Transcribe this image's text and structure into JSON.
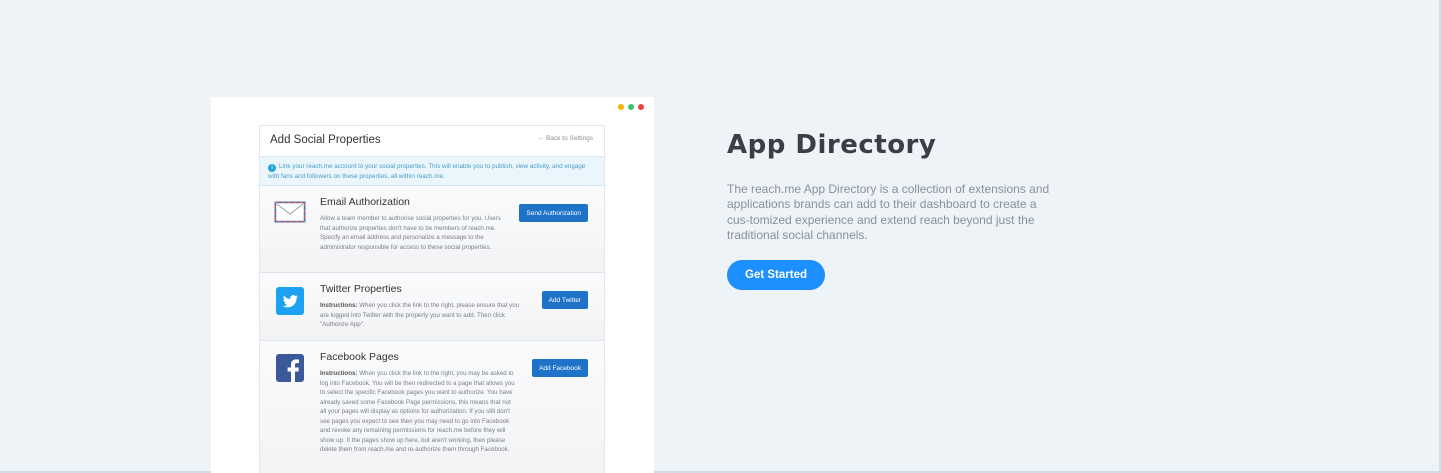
{
  "colors": {
    "accent": "#1e8fff",
    "button": "#1e73c8",
    "dot_yellow": "#f4b400",
    "dot_green": "#3cc46a",
    "dot_red": "#e8453c"
  },
  "mock": {
    "title": "Add Social Properties",
    "back_link": "← Back to Settings",
    "info_text": "Link your reach.me account to your social properties. This will enable you to publish, view activity, and engage with fans and followers on these properties, all within reach.me.",
    "rows": [
      {
        "icon": "envelope-icon",
        "title": "Email Authorization",
        "instructions_label": "",
        "description": "Allow a team member to authorise social properties for you. Users that authorize properties don't have to be members of reach.me. Specify an email address and personalize a message to the administrator responsible for access to these social properties.",
        "button": "Send Authorization"
      },
      {
        "icon": "twitter-icon",
        "title": "Twitter Properties",
        "instructions_label": "Instructions:",
        "description": " When you click the link to the right, please ensure that you are logged into Twitter with the property you want to add. Then click \"Authorize App\".",
        "button": "Add Twitter"
      },
      {
        "icon": "facebook-icon",
        "title": "Facebook Pages",
        "instructions_label": "Instructions:",
        "description": " When you click the link to the right, you may be asked to log into Facebook. You will be then redirected to a page that allows you to select the specific Facebook pages you want to authorize. You have already saved some Facebook Page permissions, this means that not all your pages will display as options for authorization. If you still don't see pages you expect to see then you may need to go into Facebook and revoke any remaining permissions for reach.me before they will show up. If the pages show up here, but aren't working, then please delete them from reach.me and re-authorize them through Facebook.",
        "button": "Add Facebook"
      }
    ]
  },
  "section": {
    "title": "App Directory",
    "description": "The reach.me App Directory is a collection of extensions and applications brands can add to their dashboard to create a cus-tomized experience and extend reach beyond just the traditional social channels.",
    "cta": "Get Started"
  }
}
